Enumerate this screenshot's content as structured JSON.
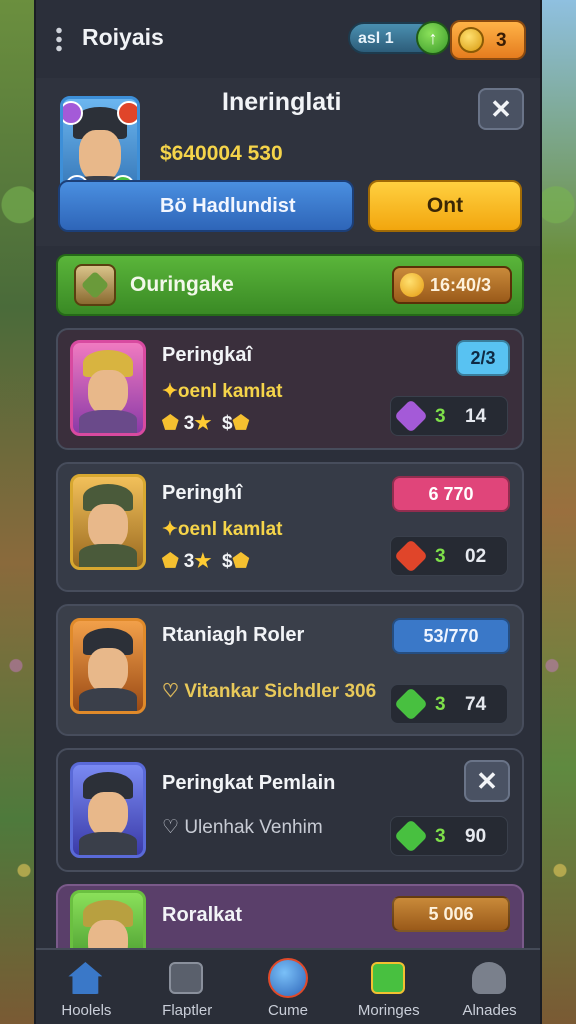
{
  "topbar": {
    "title": "Roiyais",
    "energy": "asl 1",
    "energy_plus": "↑",
    "coins": "3"
  },
  "header": {
    "name": "Ineringlati",
    "money": "$640004 530",
    "blue_button": "Bö Hadlundist",
    "yellow_button": "Ont",
    "close": "✕"
  },
  "banner": {
    "label": "Ouringake",
    "value": "16:40/3"
  },
  "cards": [
    {
      "name": "Peringkaî",
      "sub": "oenl kamlat",
      "rating_left": "3",
      "rating_right": "$",
      "badge": "2/3",
      "badge_color": "#58c2f2",
      "stat_g": "3",
      "stat_v": "14",
      "gem_color": "#a45ad8"
    },
    {
      "name": "Peringhî",
      "sub": "oenl kamlat",
      "rating_left": "3",
      "rating_right": "$",
      "badge": "6  770",
      "badge_color": "#e0457a",
      "stat_g": "3",
      "stat_v": "02",
      "gem_color": "#e0452a"
    },
    {
      "name": "Rtaniagh Roler",
      "sub": "Vitankar Sichdler 306",
      "badge": "53/770",
      "badge_color": "#3a78c8",
      "stat_g": "3",
      "stat_v": "74",
      "gem_color": "#48c040"
    },
    {
      "name": "Peringkat Pemlain",
      "sub": "Ulenhak Venhim",
      "badge": "✕",
      "stat_g": "3",
      "stat_v": "90",
      "gem_color": "#48c040"
    },
    {
      "name": "Roralkat",
      "badge": "5  006",
      "badge_color": "#c98a3a"
    }
  ],
  "nav": [
    {
      "label": "Hoolels",
      "icon": "home-icon"
    },
    {
      "label": "Flaptler",
      "icon": "map-icon"
    },
    {
      "label": "Cume",
      "icon": "compass-icon"
    },
    {
      "label": "Moringes",
      "icon": "quest-icon"
    },
    {
      "label": "Alnades",
      "icon": "profile-icon"
    }
  ]
}
